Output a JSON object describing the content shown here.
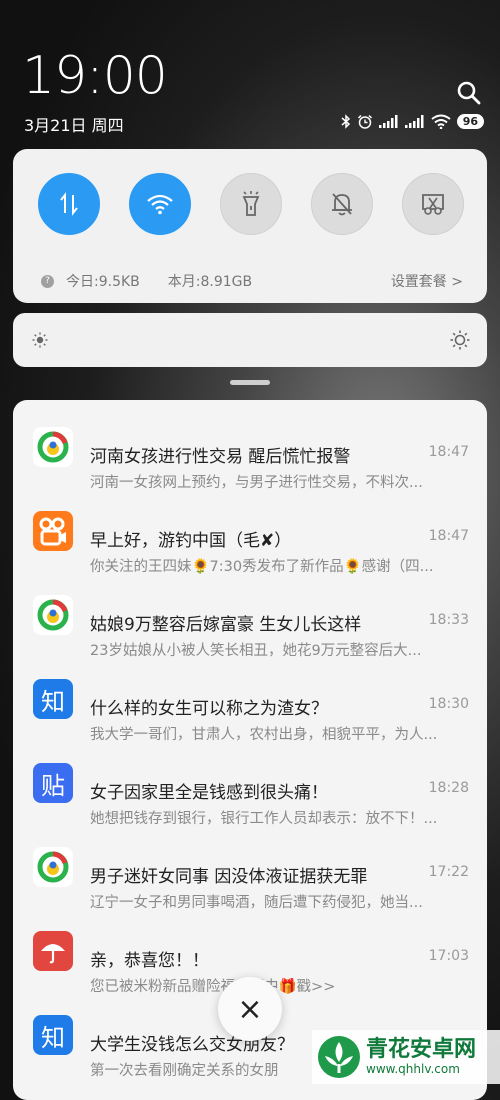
{
  "statusbar": {
    "time": "19:00",
    "date": "3月21日 周四",
    "battery": "96"
  },
  "quick_settings": {
    "tiles": [
      {
        "name": "mobile-data",
        "icon": "data-transfer-icon",
        "active": true
      },
      {
        "name": "wifi",
        "icon": "wifi-icon",
        "active": true
      },
      {
        "name": "flashlight",
        "icon": "flashlight-icon",
        "active": false
      },
      {
        "name": "mute",
        "icon": "bell-off-icon",
        "active": false
      },
      {
        "name": "screenshot",
        "icon": "scissors-icon",
        "active": false
      }
    ],
    "today_usage": "今日:9.5KB",
    "month_usage": "本月:8.91GB",
    "plan_link": "设置套餐 >"
  },
  "notifications": [
    {
      "app": "tencent-news",
      "title": "河南女孩进行性交易  醒后慌忙报警",
      "time": "18:47",
      "body": "河南一女孩网上预约，与男子进行性交易，不料次..."
    },
    {
      "app": "kuaishou",
      "title": "早上好，游钓中国（毛✘）",
      "time": "18:47",
      "body": "你关注的王四妹🌻7:30秀发布了新作品🌻感谢（四..."
    },
    {
      "app": "tencent-news",
      "title": "姑娘9万整容后嫁富豪  生女儿长这样",
      "time": "18:33",
      "body": "23岁姑娘从小被人笑长相丑，她花9万元整容后大..."
    },
    {
      "app": "zhihu",
      "title": "什么样的女生可以称之为渣女？",
      "time": "18:30",
      "body": "我大学一哥们，甘肃人，农村出身，相貌平平，为人..."
    },
    {
      "app": "tieba",
      "title": "女子因家里全是钱感到很头痛！",
      "time": "18:28",
      "body": "她想把钱存到银行，银行工作人员却表示：放不下！..."
    },
    {
      "app": "tencent-news",
      "title": "男子迷奸女同事  因没体液证据获无罪",
      "time": "17:22",
      "body": "辽宁一女子和男同事喝酒，随后遭下药侵犯，她当..."
    },
    {
      "app": "insurance",
      "title": "亲，恭喜您！！",
      "time": "17:03",
      "body": "您已被米粉新品赠险福利砸中🎁戳>>"
    },
    {
      "app": "zhihu",
      "title": "大学生没钱怎么交女朋友？",
      "time": "",
      "body": "第一次去看刚确定关系的女朋"
    }
  ],
  "app_labels": {
    "zhihu": "知",
    "tieba": "贴"
  },
  "close_button": "×",
  "watermark": {
    "title": "青花安卓网",
    "url": "www.qhhlv.com"
  }
}
